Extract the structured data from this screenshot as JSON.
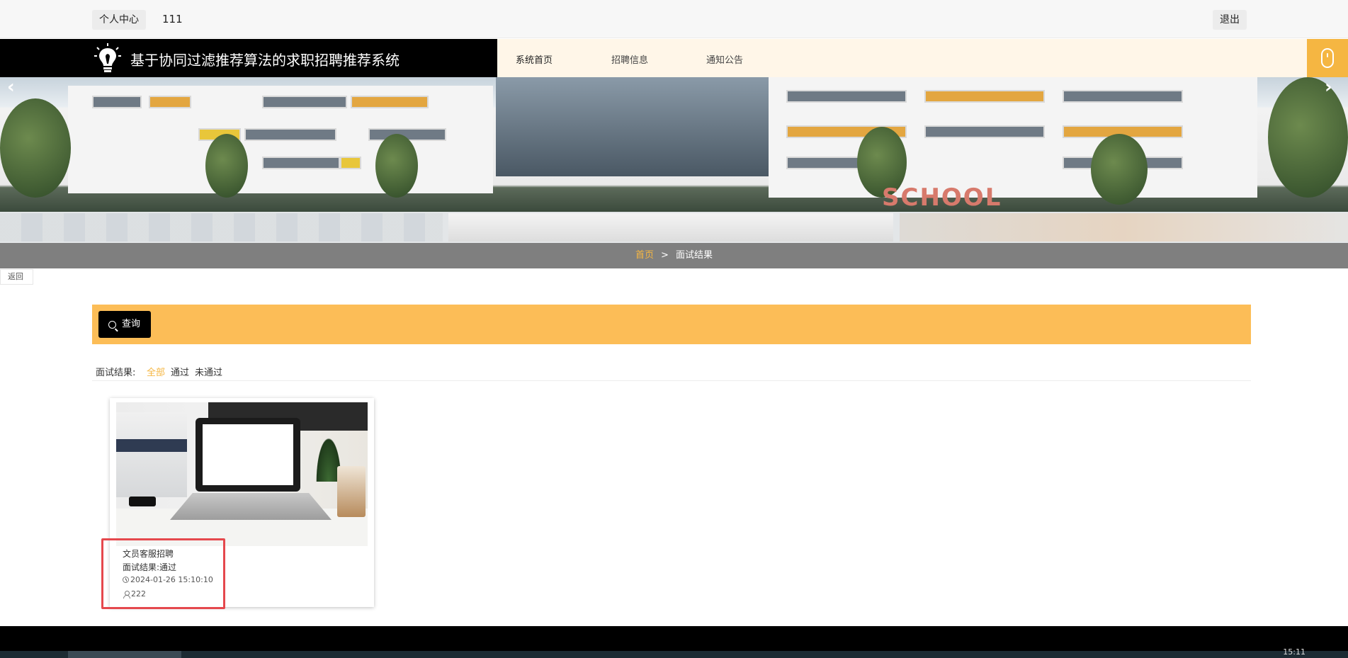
{
  "topbar": {
    "profile_label": "个人中心",
    "username": "111",
    "logout_label": "退出"
  },
  "header": {
    "site_title": "基于协同过滤推荐算法的求职招聘推荐系统",
    "nav": [
      {
        "label": "系统首页"
      },
      {
        "label": "招聘信息"
      },
      {
        "label": "通知公告"
      }
    ]
  },
  "banner": {
    "prev_icon": "chevron-left-icon",
    "next_icon": "chevron-right-icon",
    "sign_text": "SCHOOL"
  },
  "breadcrumb": {
    "home": "首页",
    "separator": ">",
    "current": "面试结果"
  },
  "back_label": "返回",
  "search": {
    "button_label": "查询",
    "icon": "search-icon"
  },
  "filter": {
    "label": "面试结果:",
    "options": [
      {
        "label": "全部",
        "active": true
      },
      {
        "label": "通过",
        "active": false
      },
      {
        "label": "未通过",
        "active": false
      }
    ]
  },
  "results": [
    {
      "job_title": "文员客服招聘",
      "result_text": "面试结果:通过",
      "datetime": "2024-01-26 15:10:10",
      "user": "222"
    }
  ],
  "taskbar": {
    "time": "15:11"
  },
  "colors": {
    "accent": "#f5b642",
    "search_bar": "#fcbd57",
    "header_bg": "#000000",
    "crumb_bg": "#7f7f7f",
    "highlight": "#e5484d"
  }
}
